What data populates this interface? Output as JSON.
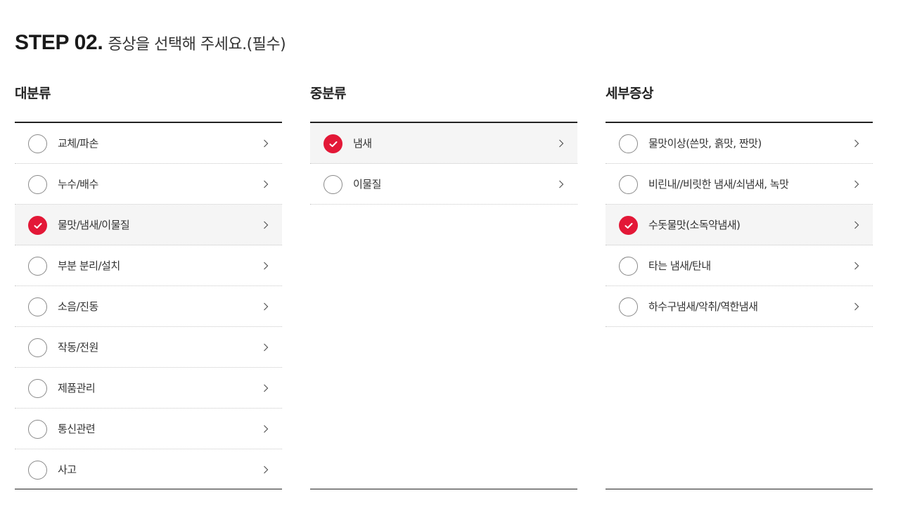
{
  "step": {
    "label": "STEP 02.",
    "description": "증상을 선택해 주세요.(필수)"
  },
  "colors": {
    "accent": "#e31837",
    "selected_bg": "#f5f5f5",
    "text": "#222222"
  },
  "columns": [
    {
      "header": "대분류",
      "items": [
        {
          "label": "교체/파손",
          "selected": false
        },
        {
          "label": "누수/배수",
          "selected": false
        },
        {
          "label": "물맛/냄새/이물질",
          "selected": true
        },
        {
          "label": "부분 분리/설치",
          "selected": false
        },
        {
          "label": "소음/진동",
          "selected": false
        },
        {
          "label": "작동/전원",
          "selected": false
        },
        {
          "label": "제품관리",
          "selected": false
        },
        {
          "label": "통신관련",
          "selected": false
        },
        {
          "label": "사고",
          "selected": false
        }
      ]
    },
    {
      "header": "중분류",
      "items": [
        {
          "label": "냄새",
          "selected": true
        },
        {
          "label": "이물질",
          "selected": false
        }
      ]
    },
    {
      "header": "세부증상",
      "items": [
        {
          "label": "물맛이상(쓴맛, 흙맛, 짠맛)",
          "selected": false
        },
        {
          "label": "비린내//비릿한 냄새/쇠냄새, 녹맛",
          "selected": false
        },
        {
          "label": "수돗물맛(소독약냄새)",
          "selected": true
        },
        {
          "label": "타는 냄새/탄내",
          "selected": false
        },
        {
          "label": "하수구냄새/악취/역한냄새",
          "selected": false
        }
      ]
    }
  ],
  "icons": {
    "radio_checked": "check-icon",
    "row_arrow": "chevron-right-icon"
  }
}
